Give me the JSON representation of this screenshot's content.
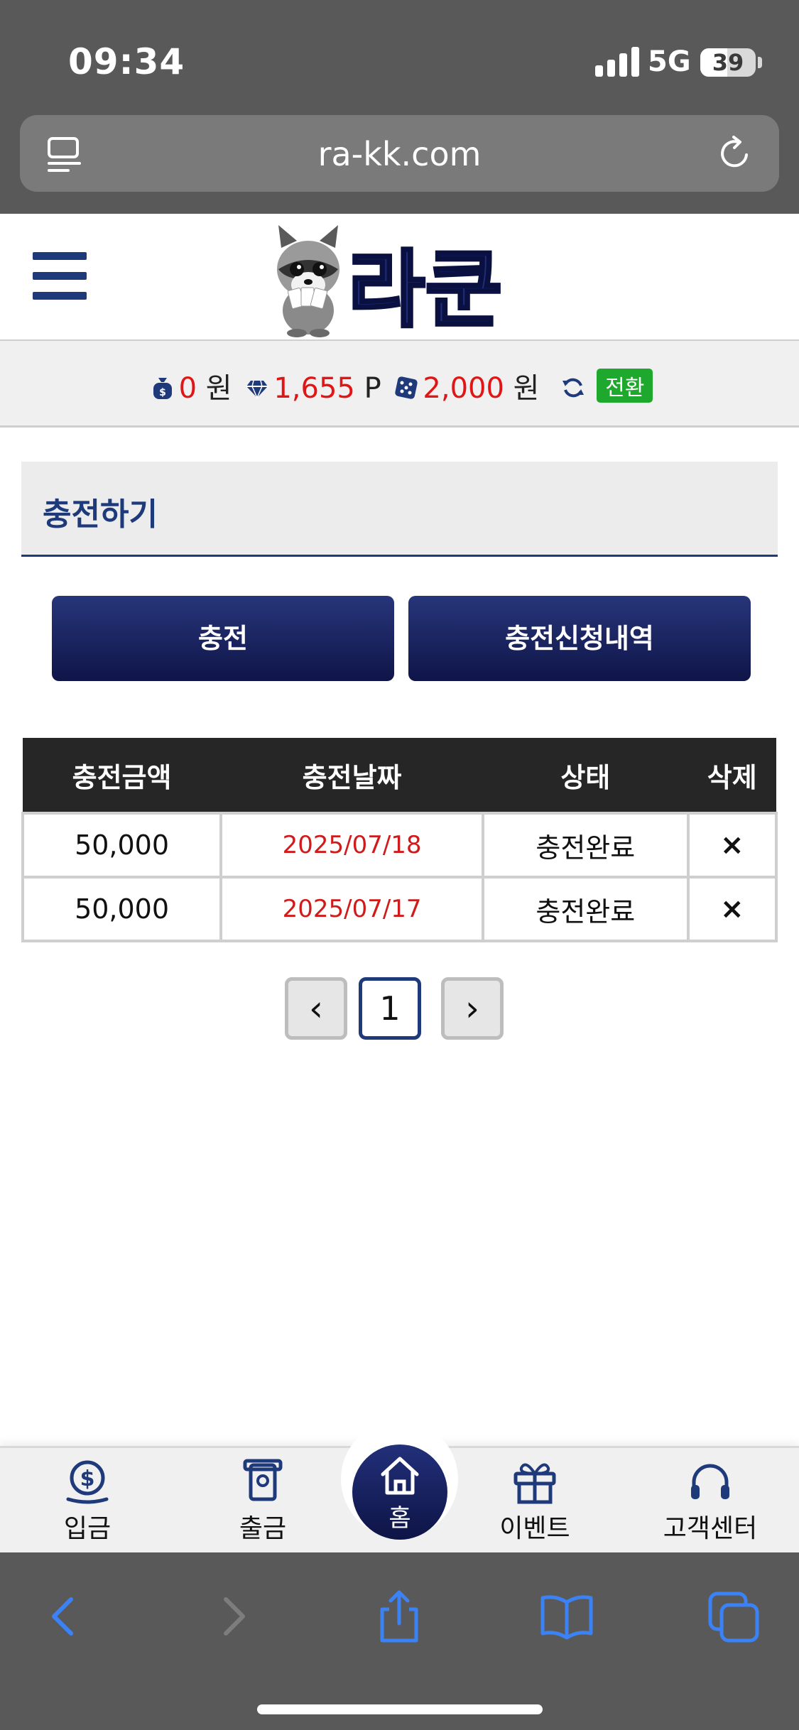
{
  "status_bar": {
    "time": "09:34",
    "network": "5G",
    "battery": "39"
  },
  "browser": {
    "url": "ra-kk.com"
  },
  "header": {
    "logo_text": "라쿤"
  },
  "balance": {
    "cash": "0",
    "cash_unit": "원",
    "points": "1,655",
    "points_unit": "P",
    "casino": "2,000",
    "casino_unit": "원",
    "convert_label": "전환"
  },
  "page": {
    "title": "충전하기",
    "tabs": [
      {
        "label": "충전"
      },
      {
        "label": "충전신청내역"
      }
    ]
  },
  "table": {
    "headers": [
      "충전금액",
      "충전날짜",
      "상태",
      "삭제"
    ],
    "rows": [
      {
        "amount": "50,000",
        "date": "2025/07/18",
        "status": "충전완료",
        "delete": "×"
      },
      {
        "amount": "50,000",
        "date": "2025/07/17",
        "status": "충전완료",
        "delete": "×"
      }
    ]
  },
  "pagination": {
    "prev": "‹",
    "current": "1",
    "next": "›"
  },
  "bottom_nav": {
    "items": [
      {
        "label": "입금",
        "icon": "deposit-icon"
      },
      {
        "label": "출금",
        "icon": "withdraw-icon"
      },
      {
        "label": "홈",
        "icon": "home-icon"
      },
      {
        "label": "이벤트",
        "icon": "gift-icon"
      },
      {
        "label": "고객센터",
        "icon": "headset-icon"
      }
    ]
  },
  "colors": {
    "navy": "#1f3a7a",
    "red": "#e01515",
    "green": "#1fa82e",
    "chrome": "#595959"
  }
}
